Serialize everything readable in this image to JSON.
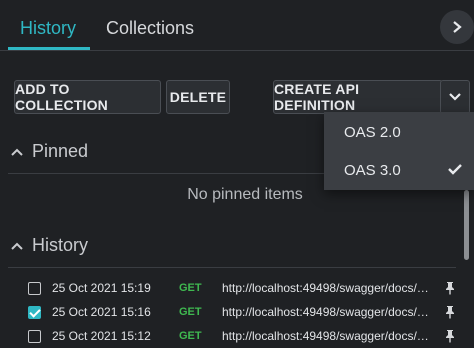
{
  "tabs": [
    {
      "label": "History",
      "active": true
    },
    {
      "label": "Collections",
      "active": false
    }
  ],
  "toolbar": {
    "add_to_collection": "ADD TO COLLECTION",
    "delete": "DELETE",
    "create_api_definition": "CREATE API DEFINITION"
  },
  "dropdown": {
    "options": [
      {
        "label": "OAS 2.0",
        "selected": false
      },
      {
        "label": "OAS 3.0",
        "selected": true
      }
    ]
  },
  "pinned": {
    "title": "Pinned",
    "empty_text": "No pinned items"
  },
  "history": {
    "title": "History",
    "rows": [
      {
        "date": "25 Oct 2021 15:19",
        "method": "GET",
        "url": "http://localhost:49498/swagger/docs/v1?u...",
        "checked": false
      },
      {
        "date": "25 Oct 2021 15:16",
        "method": "GET",
        "url": "http://localhost:49498/swagger/docs/v1?u...",
        "checked": true
      },
      {
        "date": "25 Oct 2021 15:12",
        "method": "GET",
        "url": "http://localhost:49498/swagger/docs/v1?u...",
        "checked": false
      }
    ]
  },
  "colors": {
    "accent": "#2fb8c4",
    "method_get": "#3fb950",
    "background": "#1f2124"
  },
  "icons": [
    "chevron-right-icon",
    "chevron-down-icon",
    "chevron-up-icon",
    "checkmark-icon",
    "pin-icon"
  ]
}
